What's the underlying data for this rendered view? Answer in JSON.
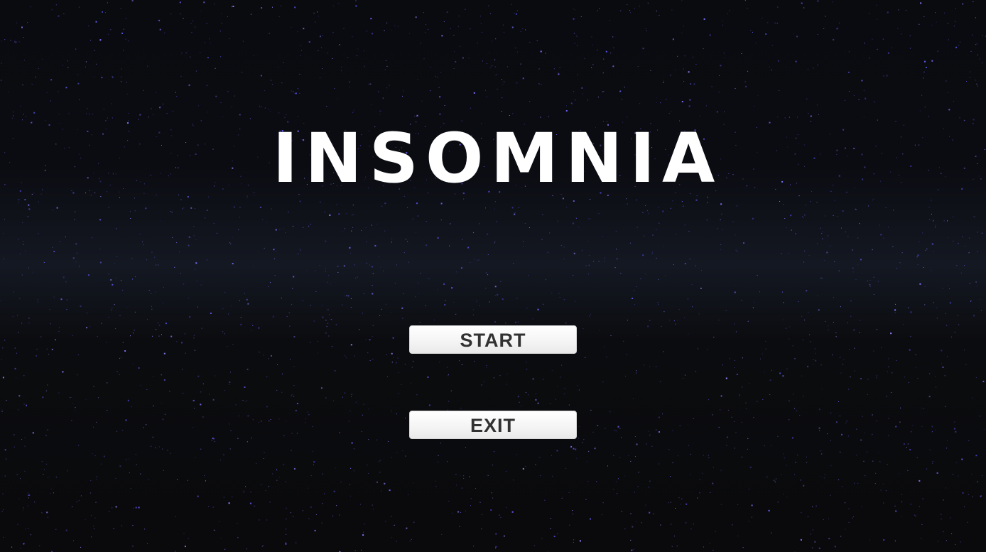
{
  "title": "INSOMNIA",
  "menu": {
    "start_label": "START",
    "exit_label": "EXIT"
  },
  "colors": {
    "title": "#ffffff",
    "star": "#6c62ff",
    "button_bg": "#f4f4f4",
    "button_text": "#323232"
  }
}
